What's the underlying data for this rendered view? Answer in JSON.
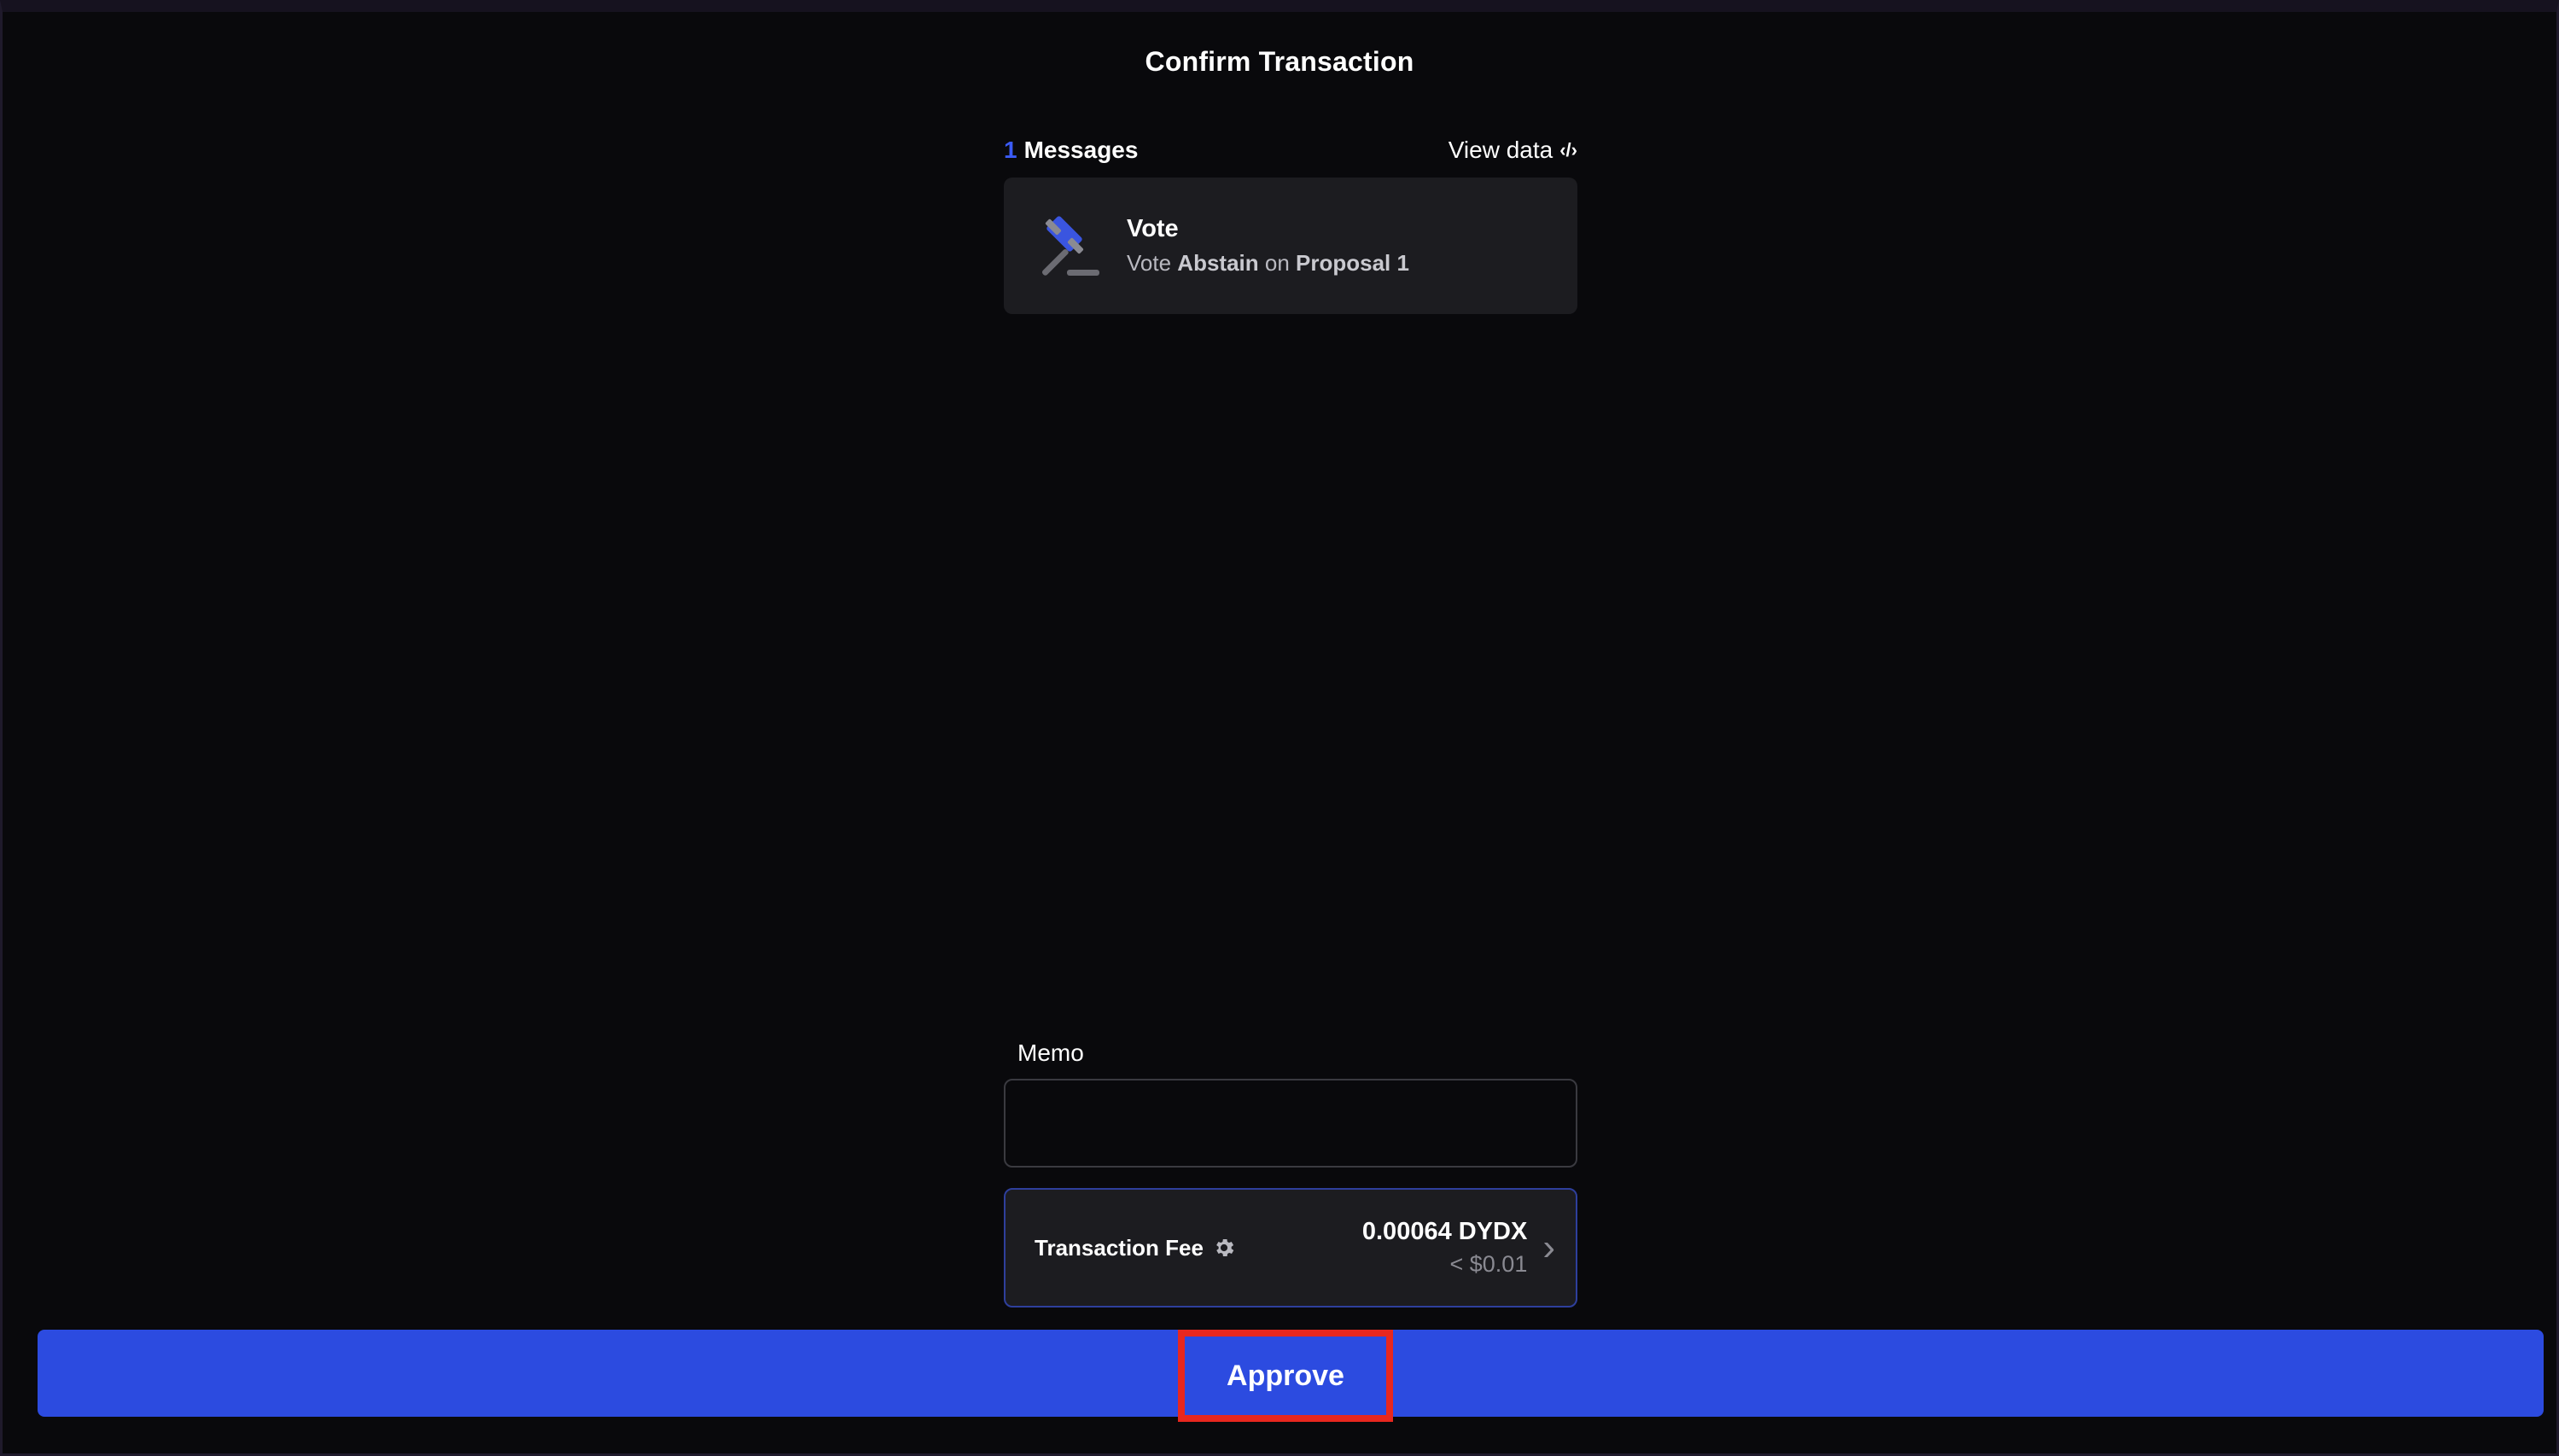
{
  "page": {
    "title": "Confirm Transaction"
  },
  "messages": {
    "count": "1",
    "label": "Messages",
    "view_data_label": "View data",
    "view_data_icon": "code-icon",
    "items": [
      {
        "icon": "gavel-icon",
        "title": "Vote",
        "desc_prefix": "Vote",
        "option": "Abstain",
        "desc_mid": "on",
        "proposal": "Proposal 1"
      }
    ]
  },
  "memo": {
    "label": "Memo",
    "value": "",
    "placeholder": ""
  },
  "fee": {
    "label": "Transaction Fee",
    "settings_icon": "gear-icon",
    "amount": "0.00064 DYDX",
    "usd": "< $0.01",
    "chevron_icon": "chevron-right-icon"
  },
  "actions": {
    "approve_label": "Approve"
  },
  "colors": {
    "accent": "#2c4be0",
    "highlight": "#e8271e",
    "count": "#3b5bf5"
  }
}
